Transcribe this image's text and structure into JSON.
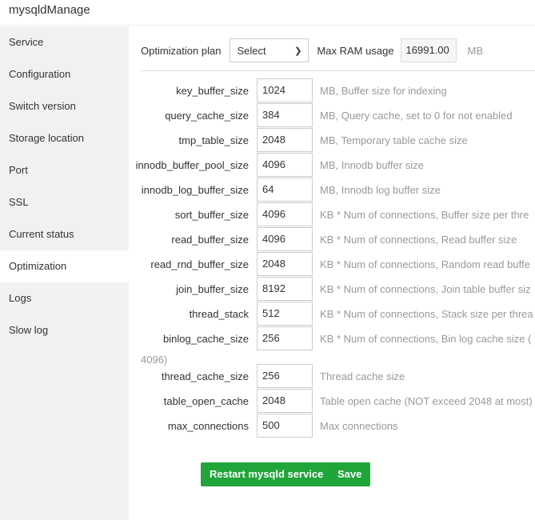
{
  "app": {
    "title": "mysqldManage"
  },
  "sidebar": {
    "items": [
      {
        "label": "Service"
      },
      {
        "label": "Configuration"
      },
      {
        "label": "Switch version"
      },
      {
        "label": "Storage location"
      },
      {
        "label": "Port"
      },
      {
        "label": "SSL"
      },
      {
        "label": "Current status"
      },
      {
        "label": "Optimization",
        "active": true
      },
      {
        "label": "Logs"
      },
      {
        "label": "Slow log"
      }
    ]
  },
  "toolbar": {
    "plan_label": "Optimization plan",
    "plan_value": "Select",
    "ram_label": "Max RAM usage",
    "ram_value": "16991.00",
    "ram_unit": "MB"
  },
  "params": [
    {
      "name": "key_buffer_size",
      "value": "1024",
      "desc": "MB, Buffer size for indexing"
    },
    {
      "name": "query_cache_size",
      "value": "384",
      "desc": "MB, Query cache, set to 0 for not enabled"
    },
    {
      "name": "tmp_table_size",
      "value": "2048",
      "desc": "MB, Temporary table cache size"
    },
    {
      "name": "innodb_buffer_pool_size",
      "value": "4096",
      "desc": "MB, Innodb buffer size"
    },
    {
      "name": "innodb_log_buffer_size",
      "value": "64",
      "desc": "MB, Innodb log buffer size"
    },
    {
      "name": "sort_buffer_size",
      "value": "4096",
      "desc": "KB * Num of connections, Buffer size per thre"
    },
    {
      "name": "read_buffer_size",
      "value": "4096",
      "desc": "KB * Num of connections, Read buffer size"
    },
    {
      "name": "read_rnd_buffer_size",
      "value": "2048",
      "desc": "KB * Num of connections, Random read buffe"
    },
    {
      "name": "join_buffer_size",
      "value": "8192",
      "desc": "KB * Num of connections, Join table buffer siz"
    },
    {
      "name": "thread_stack",
      "value": "512",
      "desc": "KB * Num of connections, Stack size per threa"
    },
    {
      "name": "binlog_cache_size",
      "value": "256",
      "desc": "KB * Num of connections, Bin log cache size ("
    },
    {
      "name": "thread_cache_size",
      "value": "256",
      "desc": "Thread cache size"
    },
    {
      "name": "table_open_cache",
      "value": "2048",
      "desc": "Table open cache (NOT exceed 2048 at most)"
    },
    {
      "name": "max_connections",
      "value": "500",
      "desc": "Max connections"
    }
  ],
  "binlog_wrap": "4096)",
  "buttons": {
    "restart": "Restart mysqld service",
    "save": "Save"
  }
}
